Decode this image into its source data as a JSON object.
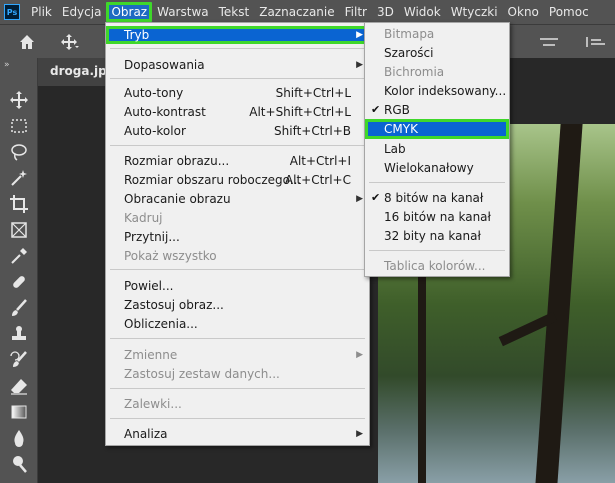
{
  "app": {
    "logo_text": "Ps"
  },
  "menubar": {
    "items": [
      "Plik",
      "Edycja",
      "Obraz",
      "Warstwa",
      "Tekst",
      "Zaznaczanie",
      "Filtr",
      "3D",
      "Widok",
      "Wtyczki",
      "Okno",
      "Pomoc"
    ],
    "active_index": 2
  },
  "document": {
    "tab_title": "droga.jpg"
  },
  "toolbar": {
    "collapse_glyph": "»"
  },
  "main_menu": {
    "items": [
      {
        "label": "Tryb",
        "shortcut": "",
        "submenu": true,
        "disabled": false,
        "selected": true
      },
      {
        "label": "Dopasowania",
        "shortcut": "",
        "submenu": true,
        "disabled": false
      },
      {
        "label": "Auto-tony",
        "shortcut": "Shift+Ctrl+L",
        "submenu": false,
        "disabled": false
      },
      {
        "label": "Auto-kontrast",
        "shortcut": "Alt+Shift+Ctrl+L",
        "submenu": false,
        "disabled": false
      },
      {
        "label": "Auto-kolor",
        "shortcut": "Shift+Ctrl+B",
        "submenu": false,
        "disabled": false
      },
      {
        "label": "Rozmiar obrazu...",
        "shortcut": "Alt+Ctrl+I",
        "submenu": false,
        "disabled": false
      },
      {
        "label": "Rozmiar obszaru roboczego...",
        "shortcut": "Alt+Ctrl+C",
        "submenu": false,
        "disabled": false
      },
      {
        "label": "Obracanie obrazu",
        "shortcut": "",
        "submenu": true,
        "disabled": false
      },
      {
        "label": "Kadruj",
        "shortcut": "",
        "submenu": false,
        "disabled": true
      },
      {
        "label": "Przytnij...",
        "shortcut": "",
        "submenu": false,
        "disabled": false
      },
      {
        "label": "Pokaż wszystko",
        "shortcut": "",
        "submenu": false,
        "disabled": true
      },
      {
        "label": "Powiel...",
        "shortcut": "",
        "submenu": false,
        "disabled": false
      },
      {
        "label": "Zastosuj obraz...",
        "shortcut": "",
        "submenu": false,
        "disabled": false
      },
      {
        "label": "Obliczenia...",
        "shortcut": "",
        "submenu": false,
        "disabled": false
      },
      {
        "label": "Zmienne",
        "shortcut": "",
        "submenu": true,
        "disabled": true
      },
      {
        "label": "Zastosuj zestaw danych...",
        "shortcut": "",
        "submenu": false,
        "disabled": true
      },
      {
        "label": "Zalewki...",
        "shortcut": "",
        "submenu": false,
        "disabled": true
      },
      {
        "label": "Analiza",
        "shortcut": "",
        "submenu": true,
        "disabled": false
      }
    ]
  },
  "mode_submenu": {
    "items": [
      {
        "label": "Bitmapa",
        "checked": false,
        "disabled": true,
        "highlighted": false
      },
      {
        "label": "Szarości",
        "checked": false,
        "disabled": false,
        "highlighted": false
      },
      {
        "label": "Bichromia",
        "checked": false,
        "disabled": true,
        "highlighted": false
      },
      {
        "label": "Kolor indeksowany...",
        "checked": false,
        "disabled": false,
        "highlighted": false
      },
      {
        "label": "RGB",
        "checked": true,
        "disabled": false,
        "highlighted": false
      },
      {
        "label": "CMYK",
        "checked": false,
        "disabled": false,
        "highlighted": true
      },
      {
        "label": "Lab",
        "checked": false,
        "disabled": false,
        "highlighted": false
      },
      {
        "label": "Wielokanałowy",
        "checked": false,
        "disabled": false,
        "highlighted": false
      },
      {
        "label": "8 bitów na kanał",
        "checked": true,
        "disabled": false,
        "highlighted": false
      },
      {
        "label": "16 bitów na kanał",
        "checked": false,
        "disabled": false,
        "highlighted": false
      },
      {
        "label": "32 bity na kanał",
        "checked": false,
        "disabled": false,
        "highlighted": false
      },
      {
        "label": "Tablica kolorów...",
        "checked": false,
        "disabled": true,
        "highlighted": false
      }
    ]
  },
  "colors": {
    "selection": "#0a64d2",
    "highlight_outline": "#3fd72a",
    "menu_bg": "#f0f0f0",
    "chrome": "#535353"
  }
}
